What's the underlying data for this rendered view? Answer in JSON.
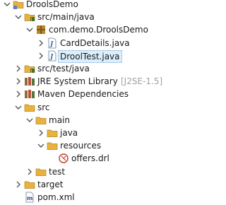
{
  "tree": {
    "items": [
      {
        "label": "DroolsDemo",
        "decoration": "",
        "icon": "project-folder-icon",
        "depth": 0,
        "expanded": true
      },
      {
        "label": "src/main/java",
        "decoration": "",
        "icon": "source-folder-icon",
        "depth": 1,
        "expanded": true
      },
      {
        "label": "com.demo.DroolsDemo",
        "decoration": "",
        "icon": "package-icon",
        "depth": 2,
        "expanded": true
      },
      {
        "label": "CardDetails.java",
        "decoration": "",
        "icon": "java-file-icon",
        "depth": 3,
        "expanded": false
      },
      {
        "label": "DroolTest.java",
        "decoration": "",
        "icon": "java-file-icon",
        "depth": 3,
        "expanded": false,
        "selected": true
      },
      {
        "label": "src/test/java",
        "decoration": "",
        "icon": "source-folder-icon",
        "depth": 1,
        "expanded": false
      },
      {
        "label": "JRE System Library",
        "decoration": "[J2SE-1.5]",
        "icon": "library-icon",
        "depth": 1,
        "expanded": false
      },
      {
        "label": "Maven Dependencies",
        "decoration": "",
        "icon": "library-icon",
        "depth": 1,
        "expanded": false
      },
      {
        "label": "src",
        "decoration": "",
        "icon": "folder-icon",
        "depth": 1,
        "expanded": true
      },
      {
        "label": "main",
        "decoration": "",
        "icon": "folder-icon",
        "depth": 2,
        "expanded": true
      },
      {
        "label": "java",
        "decoration": "",
        "icon": "folder-icon",
        "depth": 3,
        "expanded": false
      },
      {
        "label": "resources",
        "decoration": "",
        "icon": "folder-icon",
        "depth": 3,
        "expanded": true
      },
      {
        "label": "offers.drl",
        "decoration": "",
        "icon": "drools-rule-file-icon",
        "depth": 4,
        "leaf": true
      },
      {
        "label": "test",
        "decoration": "",
        "icon": "folder-icon",
        "depth": 2,
        "expanded": false
      },
      {
        "label": "target",
        "decoration": "",
        "icon": "folder-icon",
        "depth": 1,
        "expanded": false
      },
      {
        "label": "pom.xml",
        "decoration": "",
        "icon": "maven-pom-icon",
        "depth": 1,
        "leaf": true
      }
    ]
  },
  "colors": {
    "folder": "#e8b23c",
    "package": "#b8862b",
    "java": "#2c6fb7",
    "selection": "#dceefb",
    "decoration": "#a0a0a0"
  }
}
